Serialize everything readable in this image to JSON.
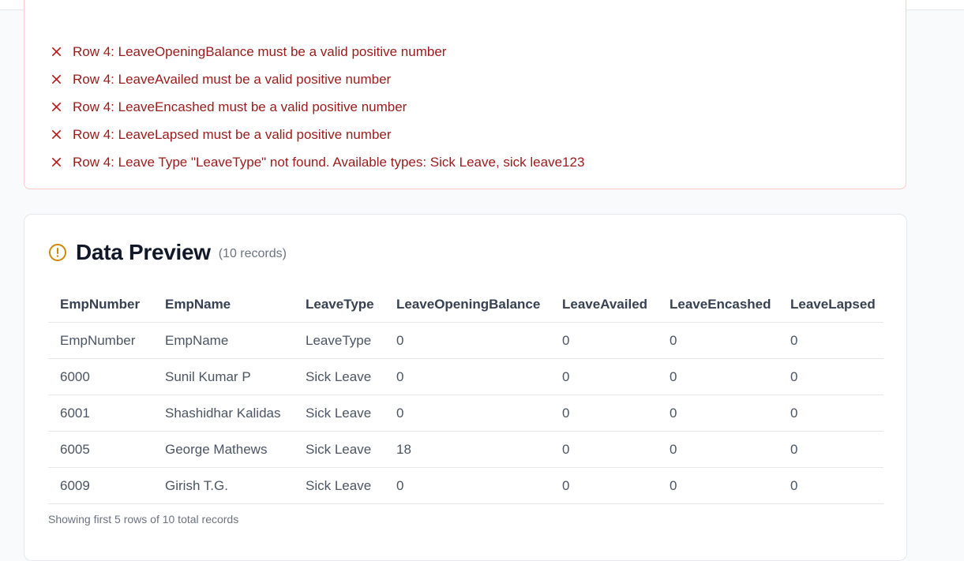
{
  "errors": [
    "Row 4: LeaveOpeningBalance must be a valid positive number",
    "Row 4: LeaveAvailed must be a valid positive number",
    "Row 4: LeaveEncashed must be a valid positive number",
    "Row 4: LeaveLapsed must be a valid positive number",
    "Row 4: Leave Type \"LeaveType\" not found. Available types: Sick Leave, sick leave123"
  ],
  "preview": {
    "title": "Data Preview",
    "record_count": "(10 records)",
    "columns": [
      "EmpNumber",
      "EmpName",
      "LeaveType",
      "LeaveOpeningBalance",
      "LeaveAvailed",
      "LeaveEncashed",
      "LeaveLapsed"
    ],
    "rows": [
      [
        "EmpNumber",
        "EmpName",
        "LeaveType",
        "0",
        "0",
        "0",
        "0"
      ],
      [
        "6000",
        "Sunil Kumar P",
        "Sick Leave",
        "0",
        "0",
        "0",
        "0"
      ],
      [
        "6001",
        "Shashidhar Kalidas",
        "Sick Leave",
        "0",
        "0",
        "0",
        "0"
      ],
      [
        "6005",
        "George Mathews",
        "Sick Leave",
        "18",
        "0",
        "0",
        "0"
      ],
      [
        "6009",
        "Girish T.G.",
        "Sick Leave",
        "0",
        "0",
        "0",
        "0"
      ]
    ],
    "footnote": "Showing first 5 rows of 10 total records"
  },
  "colors": {
    "error_text": "#991b1b",
    "error_border": "#fecaca",
    "warning_icon": "#ca8a04"
  }
}
